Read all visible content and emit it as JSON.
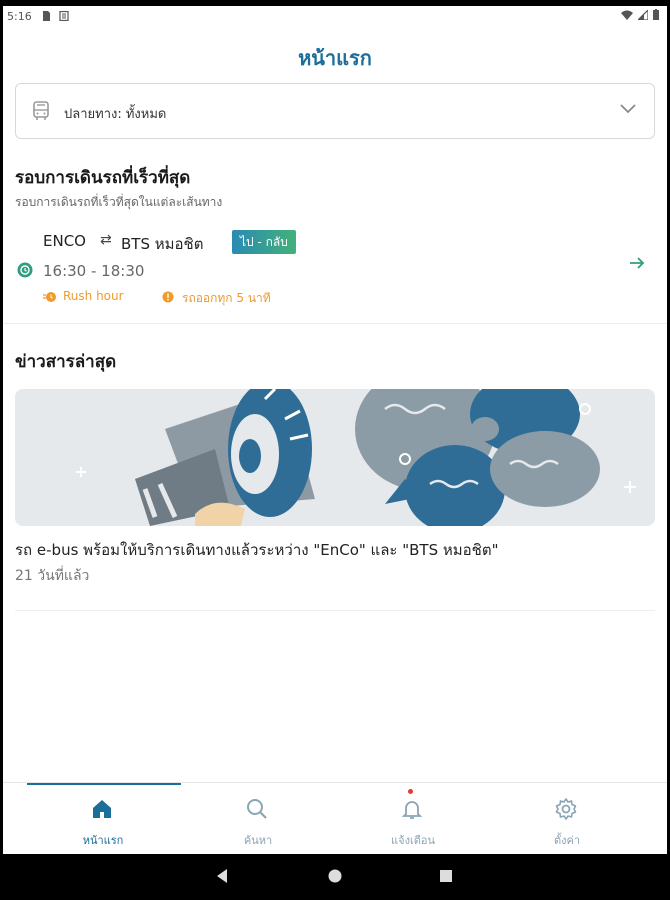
{
  "status_bar": {
    "time": "5:16"
  },
  "header": {
    "title": "หน้าแรก"
  },
  "destination_filter": {
    "label": "ปลายทาง: ทั้งหมด"
  },
  "fastest_section": {
    "title": "รอบการเดินรถที่เร็วที่สุด",
    "subtitle": "รอบการเดินรถที่เร็วที่สุดในแต่ละเส้นทาง"
  },
  "route": {
    "origin": "ENCO",
    "swap_symbol": "⇄",
    "destination": "BTS หมอชิต",
    "direction_badge": "ไป - กลับ",
    "hours": "16:30 - 18:30",
    "tag_rush": "Rush hour",
    "tag_frequency": "รถออกทุก 5 นาที"
  },
  "news_section": {
    "title": "ข่าวสารล่าสุด",
    "items": [
      {
        "title": "รถ e-bus พร้อมให้บริการเดินทางแล้วระหว่าง \"EnCo\" และ \"BTS หมอชิต\"",
        "time": "21 วันที่แล้ว"
      }
    ]
  },
  "bottom_nav": {
    "items": [
      {
        "label": "หน้าแรก",
        "icon": "home-icon",
        "active": true
      },
      {
        "label": "ค้นหา",
        "icon": "search-icon",
        "active": false
      },
      {
        "label": "แจ้งเตือน",
        "icon": "bell-icon",
        "active": false
      },
      {
        "label": "ตั้งค่า",
        "icon": "gear-icon",
        "active": false
      }
    ]
  },
  "colors": {
    "primary": "#1b6e99",
    "accent_green": "#44b07a",
    "warning_orange": "#f09a2c",
    "notification_red": "#e53935"
  }
}
